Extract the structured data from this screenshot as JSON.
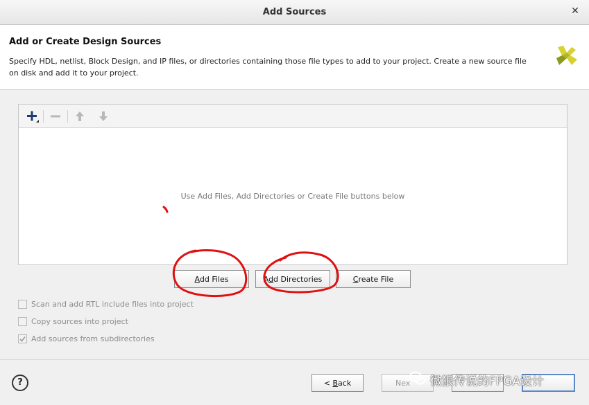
{
  "window": {
    "title": "Add Sources",
    "close_glyph": "✕"
  },
  "header": {
    "title": "Add or Create Design Sources",
    "description": "Specify HDL, netlist, Block Design, and IP files, or directories containing those file types to add to your project. Create a new source file on disk and add it to your project."
  },
  "toolbar": {
    "icons": [
      "plus-icon",
      "minus-icon",
      "arrow-up-icon",
      "arrow-down-icon"
    ]
  },
  "panel": {
    "empty_message": "Use Add Files, Add Directories or Create File buttons below"
  },
  "buttons": {
    "add_files_u": "A",
    "add_files_rest": "dd Files",
    "add_dirs_pre": "A",
    "add_dirs_u": "d",
    "add_dirs_rest": "d Directories",
    "create_u": "C",
    "create_rest": "reate File"
  },
  "options": {
    "scan_rtl": {
      "label": "Scan and add RTL include files into project",
      "checked": false
    },
    "copy_sources": {
      "label": "Copy sources into project",
      "checked": false
    },
    "add_subdirs": {
      "label": "Add sources from subdirectories",
      "checked": true
    }
  },
  "footer": {
    "help": "?",
    "back_pre": "< ",
    "back_u": "B",
    "back_rest": "ack",
    "next_visible": "Nex"
  },
  "watermark": {
    "text": "微狼传说的FPGA设计"
  },
  "colors": {
    "accent": "#5b89c8",
    "annotation_red": "#e01010",
    "logo_yellow": "#d8d230",
    "logo_green": "#8c9a1c"
  }
}
